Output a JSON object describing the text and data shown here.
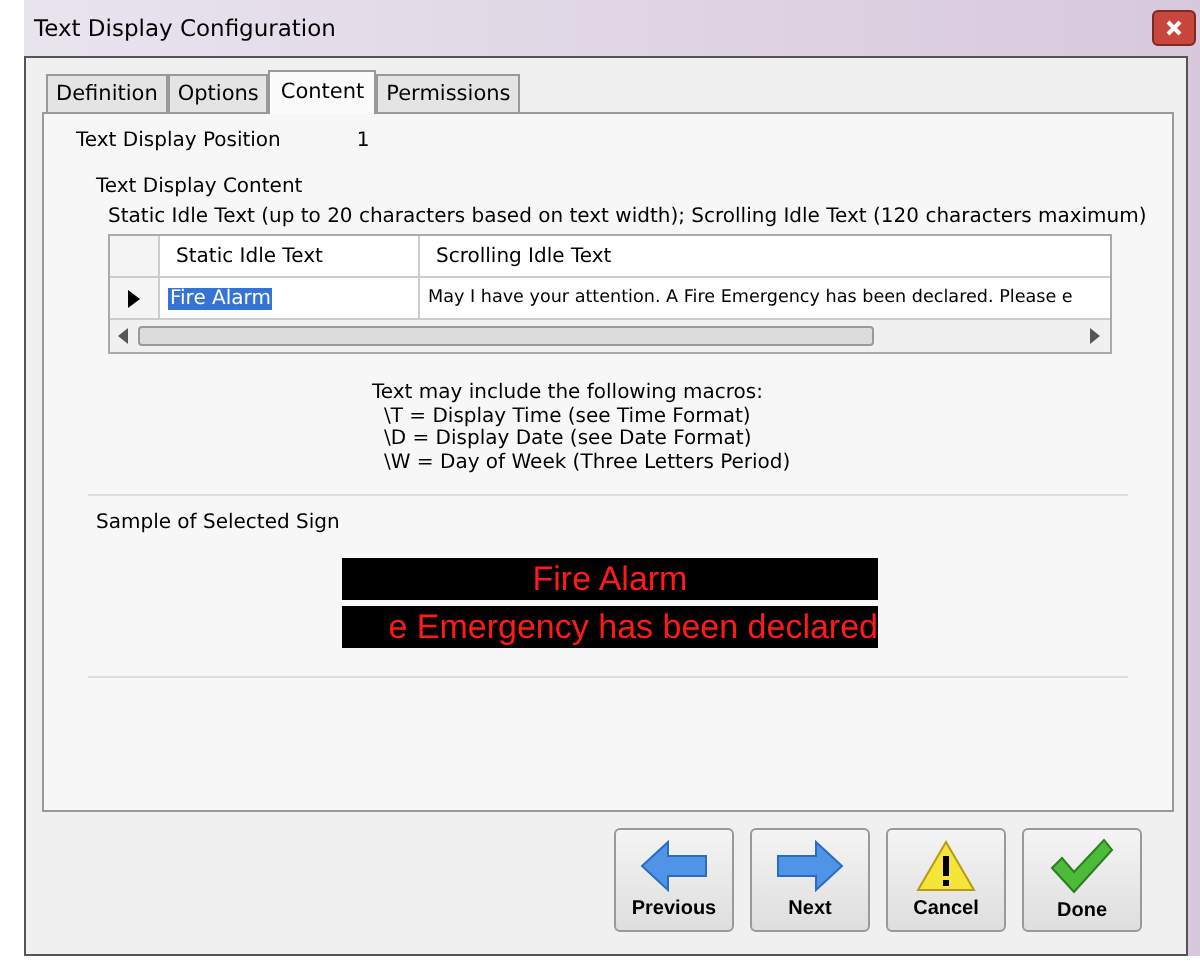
{
  "window": {
    "title": "Text Display Configuration"
  },
  "tabs": [
    {
      "label": "Definition",
      "selected": false
    },
    {
      "label": "Options",
      "selected": false
    },
    {
      "label": "Content",
      "selected": true
    },
    {
      "label": "Permissions",
      "selected": false
    }
  ],
  "position": {
    "label": "Text Display Position",
    "value": "1"
  },
  "content": {
    "heading": "Text Display Content",
    "hint": "Static Idle Text (up to 20 characters based on text width); Scrolling Idle Text (120 characters maximum)",
    "table": {
      "columns": [
        "Static Idle Text",
        "Scrolling Idle Text"
      ],
      "rows": [
        {
          "current": true,
          "static": "Fire Alarm",
          "static_selected": true,
          "scrolling": "May I have your attention. A Fire Emergency has been declared. Please e"
        }
      ]
    },
    "macros": [
      "Text may include the following macros:",
      "\\T = Display Time (see Time Format)",
      "\\D = Display Date (see Date Format)",
      "\\W = Day of Week (Three Letters  Period)"
    ]
  },
  "sample": {
    "label": "Sample of Selected Sign",
    "lines": [
      "Fire Alarm",
      "e Emergency has been declared"
    ]
  },
  "buttons": [
    {
      "label": "Previous",
      "kind": "back"
    },
    {
      "label": "Next",
      "kind": "next"
    },
    {
      "label": "Cancel",
      "kind": "warning"
    },
    {
      "label": "Done",
      "kind": "check"
    }
  ]
}
